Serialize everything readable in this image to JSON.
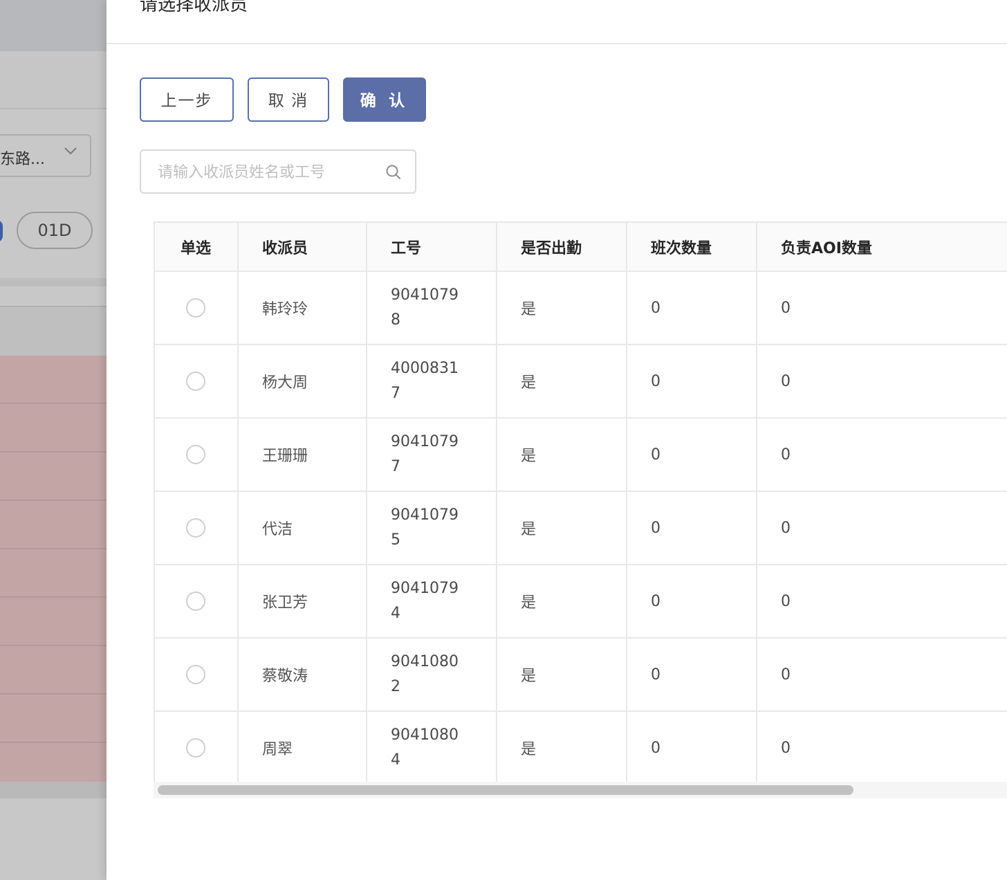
{
  "background": {
    "select_text": "东路...",
    "pill_label": "01D"
  },
  "drawer": {
    "title": "请选择收派员",
    "buttons": {
      "prev": "上一步",
      "cancel": "取 消",
      "confirm": "确 认"
    },
    "search": {
      "placeholder": "请输入收派员姓名或工号",
      "value": ""
    },
    "table": {
      "columns": [
        "单选",
        "收派员",
        "工号",
        "是否出勤",
        "班次数量",
        "负责AOI数量"
      ],
      "rows": [
        {
          "name": "韩玲玲",
          "id_line1": "9041079",
          "id_line2": "8",
          "attendance": "是",
          "shifts": "0",
          "aoi": "0"
        },
        {
          "name": "杨大周",
          "id_line1": "4000831",
          "id_line2": "7",
          "attendance": "是",
          "shifts": "0",
          "aoi": "0"
        },
        {
          "name": "王珊珊",
          "id_line1": "9041079",
          "id_line2": "7",
          "attendance": "是",
          "shifts": "0",
          "aoi": "0"
        },
        {
          "name": "代洁",
          "id_line1": "9041079",
          "id_line2": "5",
          "attendance": "是",
          "shifts": "0",
          "aoi": "0"
        },
        {
          "name": "张卫芳",
          "id_line1": "9041079",
          "id_line2": "4",
          "attendance": "是",
          "shifts": "0",
          "aoi": "0"
        },
        {
          "name": "蔡敬涛",
          "id_line1": "9041080",
          "id_line2": "2",
          "attendance": "是",
          "shifts": "0",
          "aoi": "0"
        },
        {
          "name": "周翠",
          "id_line1": "9041080",
          "id_line2": "4",
          "attendance": "是",
          "shifts": "0",
          "aoi": "0"
        }
      ]
    }
  },
  "colors": {
    "primary": "#5b6ea8",
    "overlay": "#c8c8c8",
    "row_highlight_bg": "#c3a5a6"
  }
}
